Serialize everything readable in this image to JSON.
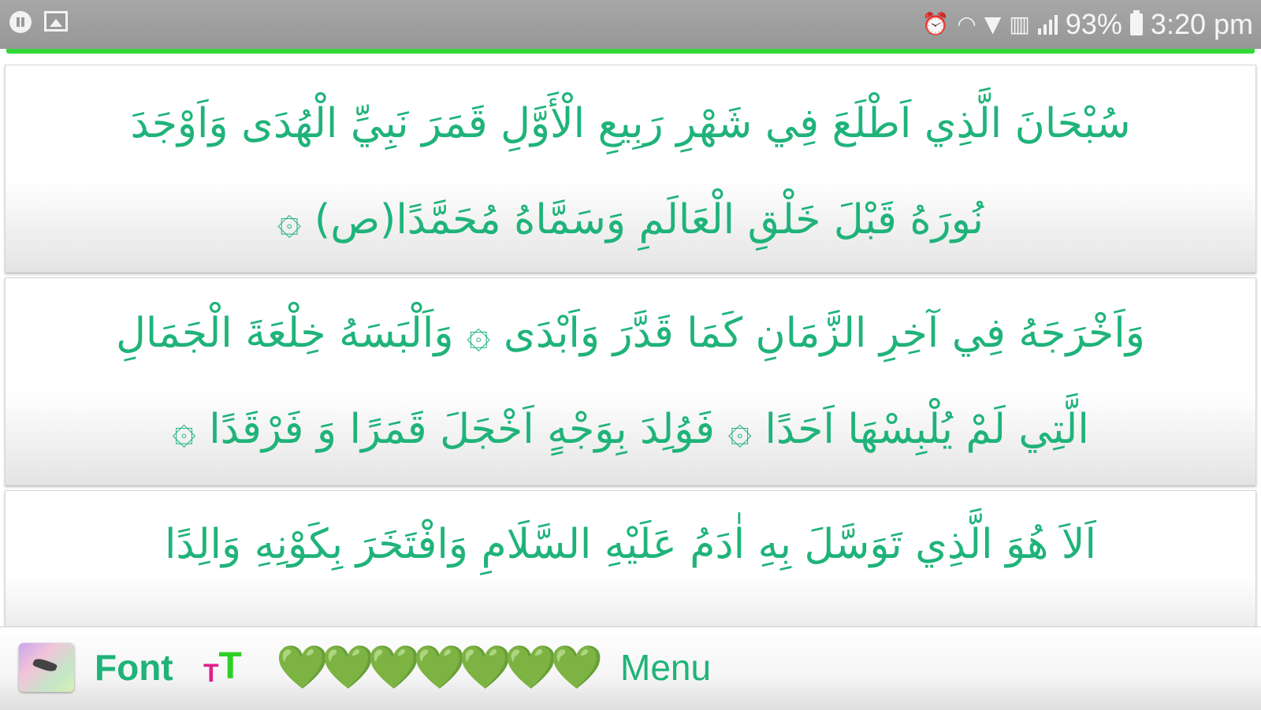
{
  "status_bar": {
    "battery_percent": "93%",
    "time": "3:20 pm"
  },
  "verses": [
    {
      "line1": "سُبْحَانَ الَّذِي اَطْلَعَ فِي شَهْرِ رَبِيعِ الْأَوَّلِ قَمَرَ نَبِيِّ الْهُدَى وَاَوْجَدَ",
      "line2": "نُورَهُ قَبْلَ خَلْقِ الْعَالَمِ وَسَمَّاهُ مُحَمَّدًا(ص) ۞"
    },
    {
      "line1": "وَاَخْرَجَهُ فِي آخِرِ الزَّمَانِ كَمَا قَدَّرَ وَاَبْدَى ۞ وَاَلْبَسَهُ خِلْعَةَ الْجَمَالِ",
      "line2": "الَّتِي لَمْ يُلْبِسْهَا اَحَدًا ۞ فَوُلِدَ بِوَجْهٍ اَخْجَلَ قَمَرًا وَ فَرْقَدًا ۞"
    },
    {
      "line1": "اَلاَ هُوَ الَّذِي تَوَسَّلَ بِهِ اٰدَمُ عَلَيْهِ السَّلَامِ وَافْتَخَرَ بِكَوْنِهِ وَالِدًا"
    }
  ],
  "toolbar": {
    "font_label": "Font",
    "font_size_small": "T",
    "font_size_large": "T",
    "hearts": [
      "💚",
      "💚",
      "💚",
      "💚",
      "💚",
      "💚",
      "💚"
    ],
    "menu_label": "Menu"
  },
  "colors": {
    "verse_text": "#1fb37a",
    "accent_line": "#32d838",
    "status_bar": "#9f9f9f",
    "heart": "#66cc1c"
  }
}
